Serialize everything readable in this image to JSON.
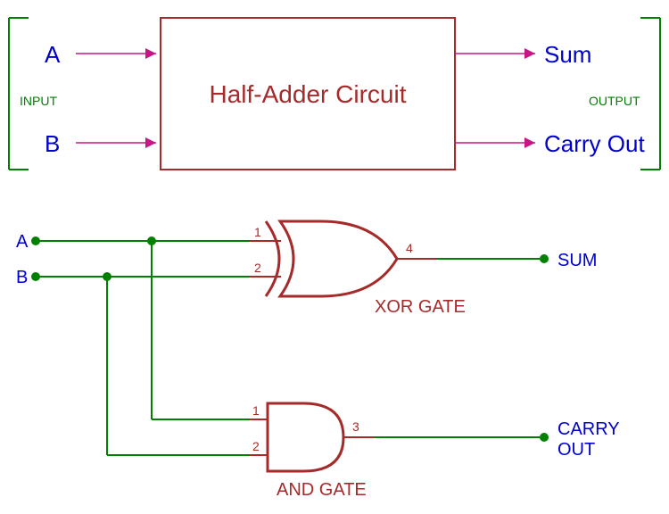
{
  "block": {
    "title": "Half-Adder Circuit",
    "inputs": {
      "A": "A",
      "B": "B",
      "section": "INPUT"
    },
    "outputs": {
      "sum": "Sum",
      "carry": "Carry Out",
      "section": "OUTPUT"
    }
  },
  "circuit": {
    "inputs": {
      "A": "A",
      "B": "B"
    },
    "outputs": {
      "sum": "SUM",
      "carry_l1": "CARRY",
      "carry_l2": "OUT"
    },
    "gates": {
      "xor": {
        "label": "XOR GATE",
        "pin1": "1",
        "pin2": "2",
        "pinOut": "4"
      },
      "and": {
        "label": "AND GATE",
        "pin1": "1",
        "pin2": "2",
        "pinOut": "3"
      }
    }
  }
}
